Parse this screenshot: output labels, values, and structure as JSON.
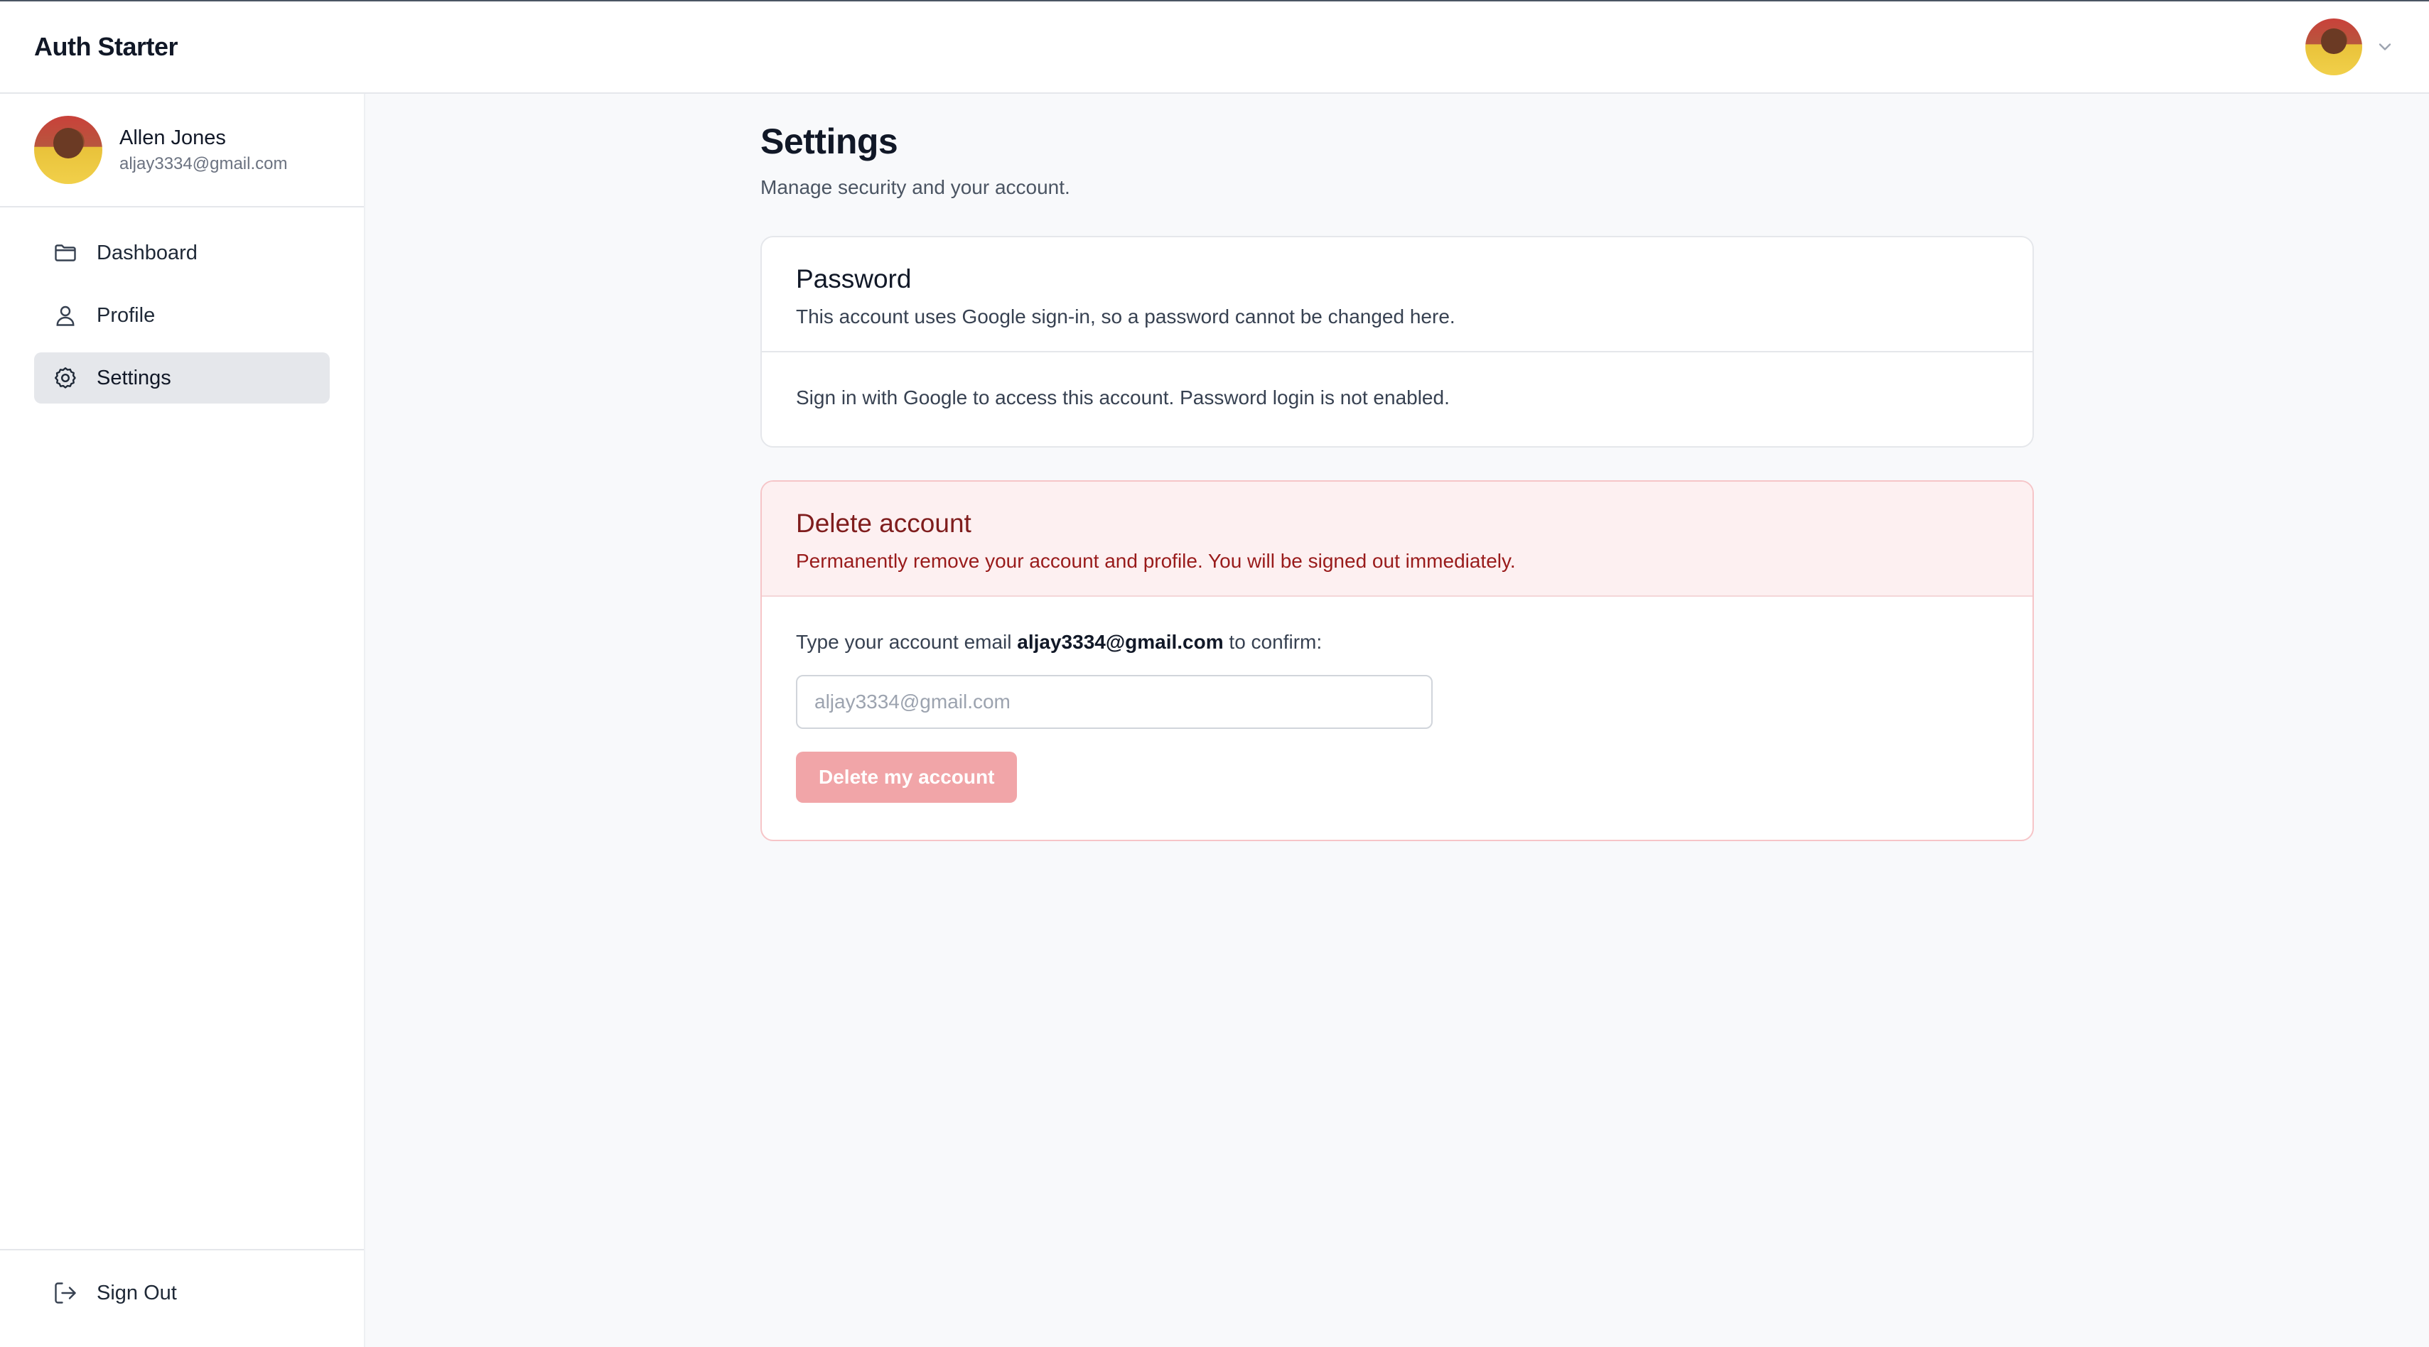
{
  "app": {
    "brand": "Auth Starter"
  },
  "user": {
    "name": "Allen Jones",
    "email": "aljay3334@gmail.com"
  },
  "sidebar": {
    "items": [
      {
        "label": "Dashboard",
        "icon": "folder-icon"
      },
      {
        "label": "Profile",
        "icon": "user-icon"
      },
      {
        "label": "Settings",
        "icon": "gear-icon",
        "active": true
      }
    ],
    "signout_label": "Sign Out"
  },
  "page": {
    "title": "Settings",
    "subtitle": "Manage security and your account."
  },
  "password_card": {
    "title": "Password",
    "description": "This account uses Google sign-in, so a password cannot be changed here.",
    "body": "Sign in with Google to access this account. Password login is not enabled."
  },
  "delete_card": {
    "title": "Delete account",
    "description": "Permanently remove your account and profile. You will be signed out immediately.",
    "confirm_prefix": "Type your account email",
    "confirm_email": "aljay3334@gmail.com",
    "confirm_suffix": "to confirm:",
    "input_value": "",
    "input_placeholder": "aljay3334@gmail.com",
    "button_label": "Delete my account"
  },
  "colors": {
    "accent_danger": "#7f1d1d",
    "danger_bg": "#fdf0f1",
    "button_disabled": "#f1a5a8"
  }
}
